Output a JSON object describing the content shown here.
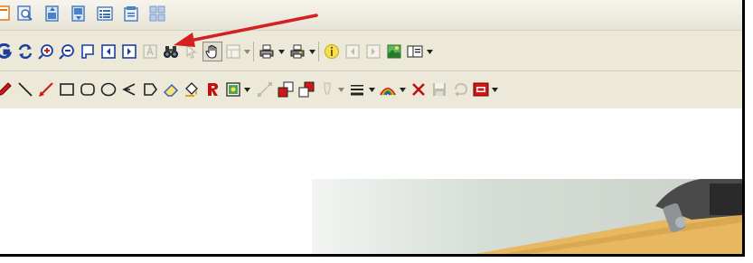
{
  "toolbar_top": {
    "buttons": [
      {
        "name": "page-view-icon"
      },
      {
        "name": "zoom-page-icon"
      },
      {
        "name": "export-page-icon"
      },
      {
        "name": "import-page-icon"
      },
      {
        "name": "list-view-icon"
      },
      {
        "name": "properties-icon"
      },
      {
        "name": "grid-view-icon"
      }
    ]
  },
  "toolbar_nav": {
    "buttons": [
      {
        "name": "page-g-icon"
      },
      {
        "name": "refresh-icon"
      },
      {
        "name": "zoom-in-icon"
      },
      {
        "name": "zoom-out-icon"
      },
      {
        "name": "fit-page-icon"
      },
      {
        "name": "previous-page-icon"
      },
      {
        "name": "next-page-icon"
      },
      {
        "name": "text-tool-icon"
      },
      {
        "name": "find-binoculars-icon"
      },
      {
        "name": "select-tool-icon"
      },
      {
        "name": "hand-pan-icon"
      },
      {
        "name": "layout-icon"
      },
      {
        "name": "print-icon"
      },
      {
        "name": "print-setup-icon"
      },
      {
        "name": "info-icon"
      },
      {
        "name": "page-first-icon"
      },
      {
        "name": "page-last-icon"
      },
      {
        "name": "image-icon"
      },
      {
        "name": "book-icon"
      }
    ]
  },
  "toolbar_draw": {
    "buttons": [
      {
        "name": "marker-tool-icon"
      },
      {
        "name": "line-tool-icon"
      },
      {
        "name": "arrow-tool-icon"
      },
      {
        "name": "rectangle-tool-icon"
      },
      {
        "name": "rounded-rectangle-tool-icon"
      },
      {
        "name": "ellipse-tool-icon"
      },
      {
        "name": "polyline-tool-icon"
      },
      {
        "name": "polygon-tool-icon"
      },
      {
        "name": "eraser-tool-icon"
      },
      {
        "name": "fill-bucket-icon"
      },
      {
        "name": "rubber-stamp-r-icon"
      },
      {
        "name": "stamp-icon"
      },
      {
        "name": "connector-icon"
      },
      {
        "name": "bring-to-front-icon"
      },
      {
        "name": "send-to-back-icon"
      },
      {
        "name": "highlighter-icon"
      },
      {
        "name": "line-style-icon"
      },
      {
        "name": "color-palette-icon"
      },
      {
        "name": "delete-annotation-icon"
      },
      {
        "name": "save-annotation-icon"
      },
      {
        "name": "undo-icon"
      },
      {
        "name": "redact-rs-icon"
      }
    ]
  },
  "colors": {
    "toolbar_bg": "#ece9d8",
    "annotation_arrow": "#d42020",
    "frame_border": "#000000"
  }
}
